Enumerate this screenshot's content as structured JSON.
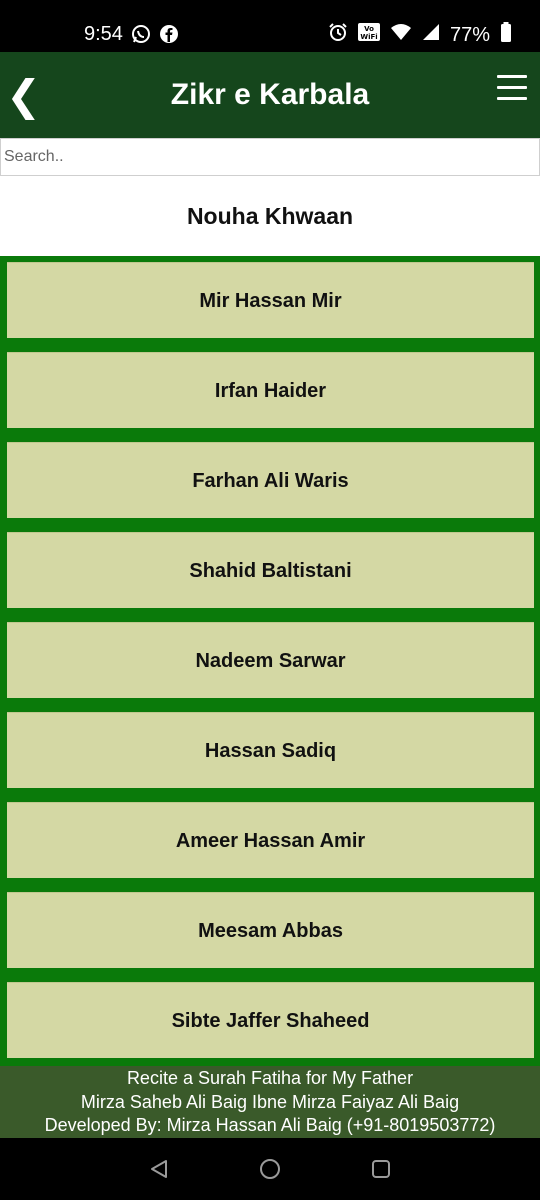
{
  "status_bar": {
    "time": "9:54",
    "battery": "77%",
    "left_icons": [
      "whatsapp-icon",
      "facebook-icon"
    ],
    "right_icons": [
      "alarm-icon",
      "vowifi-icon",
      "wifi-icon",
      "signal-icon",
      "battery-icon"
    ],
    "vowifi_label": "Vo WiFi"
  },
  "app_bar": {
    "back_glyph": "❮",
    "title": "Zikr e Karbala",
    "menu_icon": "hamburger-menu-icon"
  },
  "search": {
    "placeholder": "Search.."
  },
  "section": {
    "title": "Nouha Khwaan"
  },
  "items": [
    "Mir Hassan Mir",
    "Irfan Haider",
    "Farhan Ali Waris",
    "Shahid Baltistani",
    "Nadeem Sarwar",
    "Hassan Sadiq",
    "Ameer Hassan Amir",
    "Meesam Abbas",
    "Sibte Jaffer Shaheed"
  ],
  "footer": {
    "line1": "Recite a Surah Fatiha for My Father",
    "line2": "Mirza Saheb Ali Baig Ibne Mirza Faiyaz Ali Baig",
    "line3": "Developed By: Mirza Hassan Ali Baig (+91-8019503772)"
  },
  "colors": {
    "app_bar": "#15461c",
    "list_background": "#0a7a0a",
    "item_background": "#d4d8a4",
    "footer": "#3a5a2a"
  }
}
